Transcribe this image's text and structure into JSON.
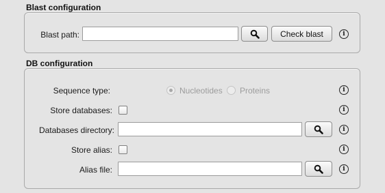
{
  "blast_configuration": {
    "title": "Blast configuration",
    "blast_path_label": "Blast path:",
    "blast_path_value": "",
    "check_blast_label": "Check blast"
  },
  "db_configuration": {
    "title": "DB configuration",
    "sequence_type_label": "Sequence type:",
    "sequence_type_options": [
      "Nucleotides",
      "Proteins"
    ],
    "sequence_type_selected": "Nucleotides",
    "store_databases_label": "Store databases:",
    "store_databases_checked": false,
    "databases_directory_label": "Databases directory:",
    "databases_directory_value": "",
    "store_alias_label": "Store alias:",
    "store_alias_checked": false,
    "alias_file_label": "Alias file:",
    "alias_file_value": ""
  },
  "icons": {
    "browse": "magnifier-icon",
    "help": "info-icon"
  }
}
